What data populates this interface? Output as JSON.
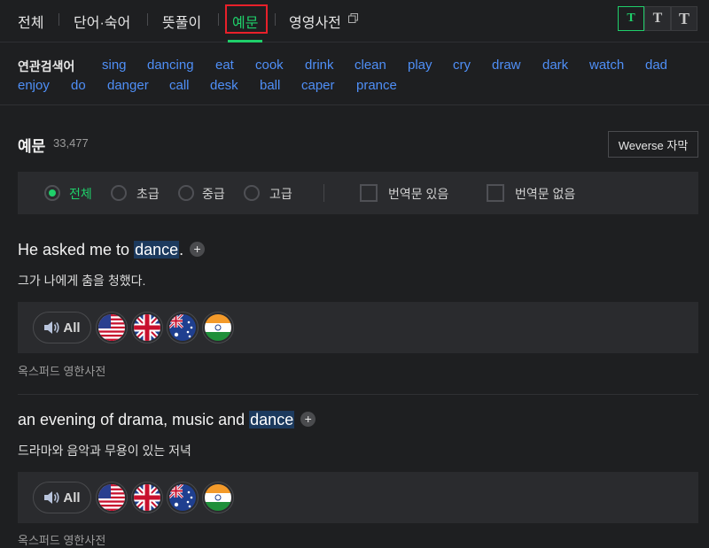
{
  "tabs": {
    "all": "전체",
    "idiom": "단어·숙어",
    "meaning": "뜻풀이",
    "examples": "예문",
    "en_en": "영영사전"
  },
  "font_buttons": [
    "T",
    "T",
    "T"
  ],
  "related": {
    "title": "연관검색어",
    "keywords": [
      "sing",
      "dancing",
      "eat",
      "cook",
      "drink",
      "clean",
      "play",
      "cry",
      "draw",
      "dark",
      "watch",
      "dad",
      "enjoy",
      "do",
      "danger",
      "call",
      "desk",
      "ball",
      "caper",
      "prance"
    ]
  },
  "examples_header": {
    "title": "예문",
    "count": "33,477",
    "weverse_button": "Weverse 자막"
  },
  "filters": {
    "levels": [
      "전체",
      "초급",
      "중급",
      "고급"
    ],
    "selected_level": "전체",
    "checkboxes": [
      "번역문 있음",
      "번역문 없음"
    ]
  },
  "examples": [
    {
      "before": "He asked me to ",
      "highlight": "dance",
      "after": ".",
      "translation": "그가 나에게 춤을 청했다.",
      "audio_all": "All",
      "source": "옥스퍼드 영한사전"
    },
    {
      "before": "an evening of drama, music and ",
      "highlight": "dance",
      "after": "",
      "translation": "드라마와 음악과 무용이 있는 저녁",
      "audio_all": "All",
      "source": "옥스퍼드 영한사전"
    }
  ],
  "colors": {
    "accent": "#1fcf6a",
    "link": "#4f8ff7",
    "active_tab_outline": "#e8202a",
    "highlight_bg": "#1c3a5e",
    "background": "#1e1f21"
  },
  "icons": [
    "copy-icon",
    "speaker-icon",
    "us-flag-icon",
    "uk-flag-icon",
    "australia-flag-icon",
    "india-flag-icon",
    "plus-icon"
  ]
}
